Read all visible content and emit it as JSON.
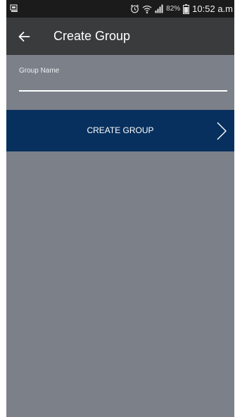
{
  "status_bar": {
    "battery_percent": "82%",
    "time": "10:52 a.m",
    "icons": [
      "notification-icon",
      "alarm-icon",
      "wifi-icon",
      "signal-icon",
      "battery-icon"
    ]
  },
  "app_bar": {
    "back_icon": "arrow-left-icon",
    "title": "Create Group"
  },
  "form": {
    "group_name_label": "Group Name",
    "group_name_value": ""
  },
  "create_button": {
    "label": "CREATE GROUP",
    "icon": "chevron-right-icon"
  },
  "colors": {
    "background": "#7c8089",
    "app_bar": "#3a3b3c",
    "status_bar": "#1b1b1b",
    "button": "#07305e",
    "text": "#ffffff"
  }
}
